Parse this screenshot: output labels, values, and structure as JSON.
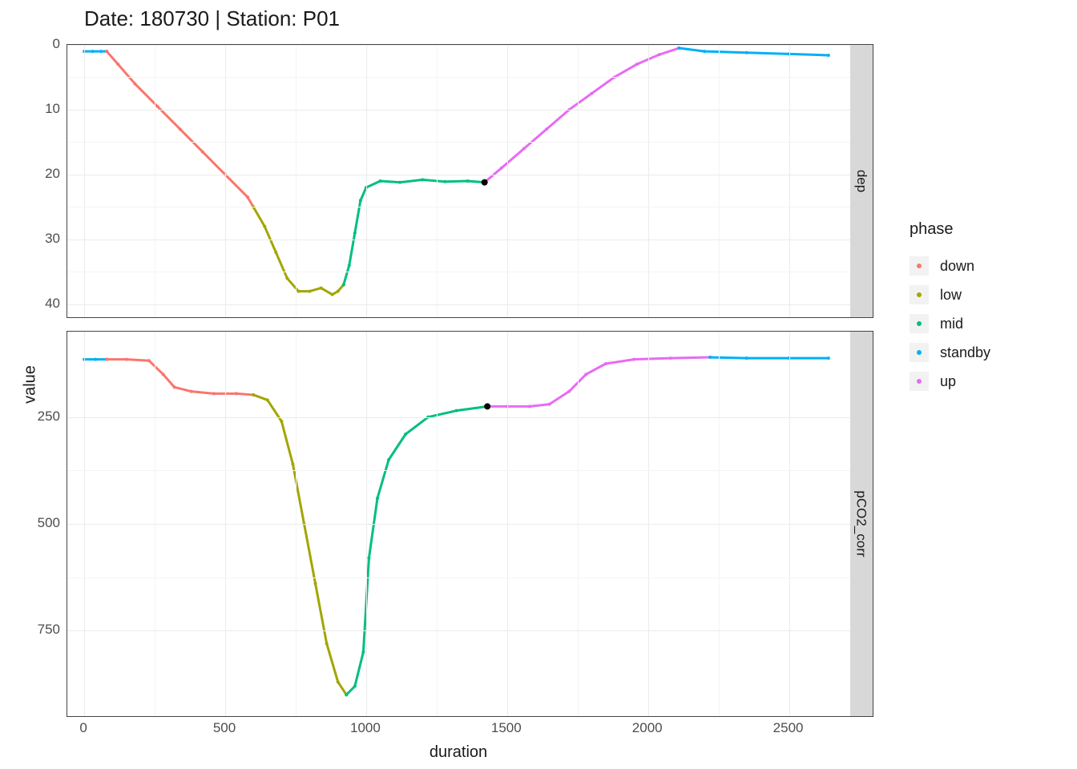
{
  "title": "Date: 180730 | Station: P01",
  "xlabel": "duration",
  "ylabel": "value",
  "facets": {
    "top": "dep",
    "bottom": "pCO2_corr"
  },
  "legend": {
    "title": "phase",
    "items": [
      {
        "name": "down",
        "color": "#F8766D"
      },
      {
        "name": "low",
        "color": "#A3A500"
      },
      {
        "name": "mid",
        "color": "#00BF7D"
      },
      {
        "name": "standby",
        "color": "#00B0F6"
      },
      {
        "name": "up",
        "color": "#E76BF3"
      }
    ]
  },
  "x_ticks": [
    0,
    500,
    1000,
    1500,
    2000,
    2500
  ],
  "panels": {
    "top": {
      "y_ticks": [
        0,
        10,
        20,
        30,
        40
      ],
      "y_reversed": true,
      "ylim": [
        0,
        42
      ]
    },
    "bottom": {
      "y_ticks": [
        250,
        500,
        750
      ],
      "y_reversed": true,
      "ylim": [
        50,
        950
      ]
    }
  },
  "chart_data": [
    {
      "type": "line",
      "facet": "dep",
      "xlabel": "duration",
      "ylabel": "value",
      "ylim": [
        0,
        42
      ],
      "y_reversed": true,
      "series": [
        {
          "name": "standby",
          "color": "#00B0F6",
          "x": [
            0,
            30,
            60,
            80
          ],
          "y": [
            1,
            1,
            1,
            1
          ]
        },
        {
          "name": "down",
          "color": "#F8766D",
          "x": [
            80,
            120,
            180,
            260,
            340,
            420,
            500,
            580,
            600
          ],
          "y": [
            1,
            3,
            6,
            9.5,
            13,
            16.5,
            20,
            23.5,
            25
          ]
        },
        {
          "name": "low",
          "color": "#A3A500",
          "x": [
            600,
            640,
            680,
            720,
            760,
            800,
            840,
            880,
            900,
            920
          ],
          "y": [
            25,
            28,
            32,
            36,
            38,
            38,
            37.5,
            38.5,
            38,
            37
          ]
        },
        {
          "name": "mid",
          "color": "#00BF7D",
          "x": [
            920,
            940,
            960,
            980,
            1000,
            1050,
            1120,
            1200,
            1280,
            1360,
            1420
          ],
          "y": [
            37,
            34,
            29,
            24,
            22,
            21,
            21.2,
            20.8,
            21.1,
            21,
            21.2
          ]
        },
        {
          "name": "up",
          "color": "#E76BF3",
          "x": [
            1420,
            1480,
            1560,
            1640,
            1720,
            1800,
            1880,
            1960,
            2040,
            2110
          ],
          "y": [
            21.2,
            19,
            16,
            13,
            10,
            7.5,
            5,
            3,
            1.5,
            0.5
          ]
        },
        {
          "name": "standby",
          "color": "#00B0F6",
          "x": [
            2110,
            2200,
            2350,
            2500,
            2640
          ],
          "y": [
            0.5,
            1,
            1.2,
            1.4,
            1.6
          ]
        }
      ],
      "marker": {
        "x": 1420,
        "y": 21.2
      }
    },
    {
      "type": "line",
      "facet": "pCO2_corr",
      "xlabel": "duration",
      "ylabel": "value",
      "ylim": [
        50,
        950
      ],
      "y_reversed": true,
      "series": [
        {
          "name": "standby",
          "color": "#00B0F6",
          "x": [
            0,
            40,
            80
          ],
          "y": [
            115,
            115,
            115
          ]
        },
        {
          "name": "down",
          "color": "#F8766D",
          "x": [
            80,
            150,
            230,
            280,
            320,
            380,
            460,
            540,
            600
          ],
          "y": [
            115,
            115,
            118,
            150,
            180,
            190,
            195,
            195,
            198
          ]
        },
        {
          "name": "low",
          "color": "#A3A500",
          "x": [
            600,
            650,
            700,
            740,
            780,
            820,
            860,
            900,
            930
          ],
          "y": [
            198,
            210,
            260,
            360,
            500,
            640,
            780,
            870,
            900
          ]
        },
        {
          "name": "mid",
          "color": "#00BF7D",
          "x": [
            930,
            960,
            990,
            1010,
            1040,
            1080,
            1140,
            1220,
            1320,
            1430
          ],
          "y": [
            900,
            880,
            800,
            580,
            440,
            350,
            290,
            250,
            235,
            225
          ]
        },
        {
          "name": "up",
          "color": "#E76BF3",
          "x": [
            1430,
            1500,
            1580,
            1650,
            1720,
            1780,
            1850,
            1950,
            2080,
            2220
          ],
          "y": [
            225,
            225,
            225,
            220,
            190,
            150,
            125,
            115,
            112,
            110
          ]
        },
        {
          "name": "standby",
          "color": "#00B0F6",
          "x": [
            2220,
            2350,
            2500,
            2640
          ],
          "y": [
            110,
            112,
            112,
            112
          ]
        }
      ],
      "marker": {
        "x": 1430,
        "y": 225
      }
    }
  ]
}
